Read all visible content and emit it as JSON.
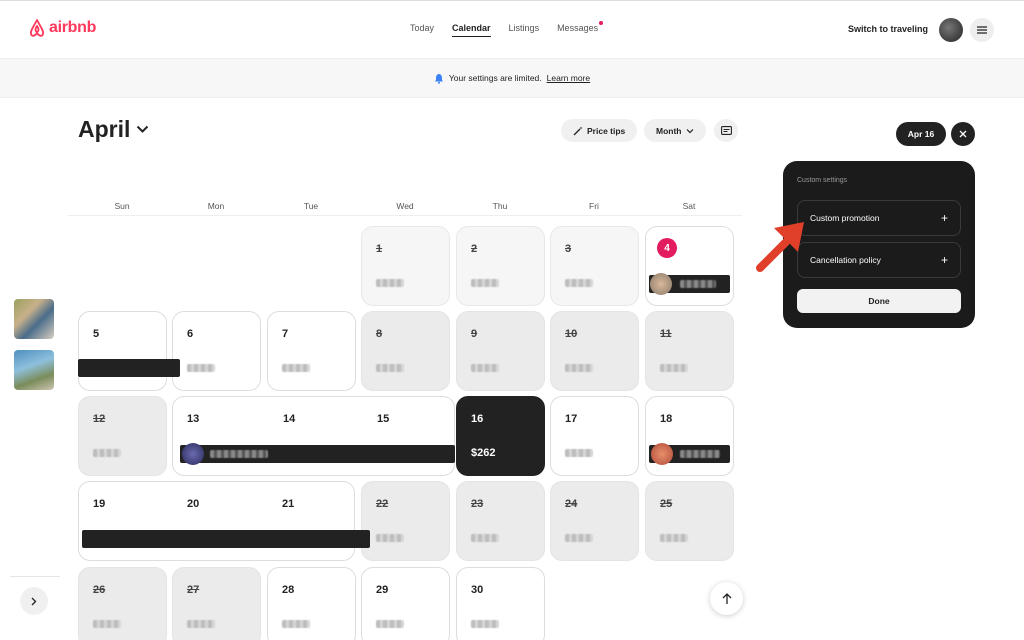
{
  "header": {
    "logo_text": "airbnb",
    "nav": [
      {
        "label": "Today"
      },
      {
        "label": "Calendar"
      },
      {
        "label": "Listings"
      },
      {
        "label": "Messages"
      }
    ],
    "switch_label": "Switch to traveling"
  },
  "banner": {
    "text": "Your settings are limited.",
    "link": "Learn more"
  },
  "calendar": {
    "month": "April",
    "price_tips_label": "Price tips",
    "view_label": "Month",
    "weekdays": [
      "Sun",
      "Mon",
      "Tue",
      "Wed",
      "Thu",
      "Fri",
      "Sat"
    ],
    "days": {
      "d1": "1",
      "d2": "2",
      "d3": "3",
      "d4": "4",
      "d5": "5",
      "d6": "6",
      "d7": "7",
      "d8": "8",
      "d9": "9",
      "d10": "10",
      "d11": "11",
      "d12": "12",
      "d13": "13",
      "d14": "14",
      "d15": "15",
      "d16": "16",
      "d17": "17",
      "d18": "18",
      "d19": "19",
      "d20": "20",
      "d21": "21",
      "d22": "22",
      "d23": "23",
      "d24": "24",
      "d25": "25",
      "d26": "26",
      "d27": "27",
      "d28": "28",
      "d29": "29",
      "d30": "30"
    },
    "selected_price": "$262"
  },
  "panel": {
    "selected_date": "Apr 16",
    "title": "Custom settings",
    "rows": [
      {
        "label": "Custom promotion"
      },
      {
        "label": "Cancellation policy"
      }
    ],
    "done_label": "Done"
  },
  "colors": {
    "brand": "#FF385C",
    "dark": "#222222",
    "today": "#E31C5F",
    "arrow": "#E0402A"
  }
}
